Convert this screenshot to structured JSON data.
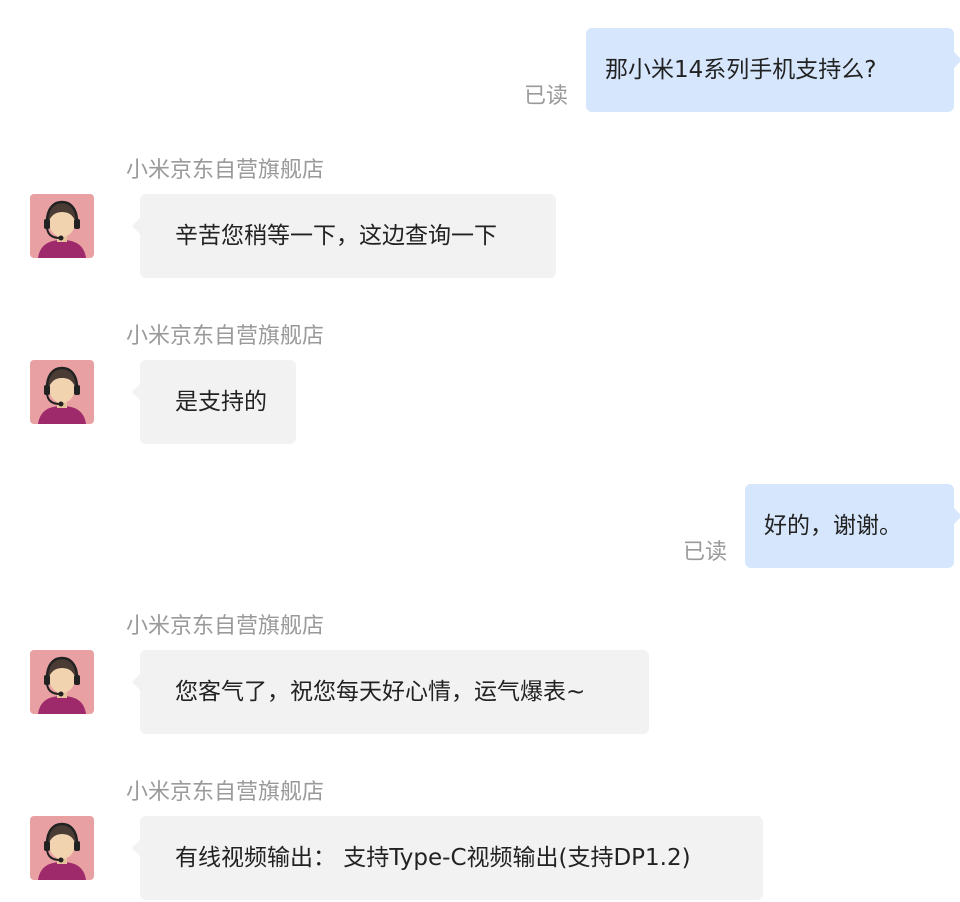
{
  "conversation": {
    "messages": [
      {
        "from": "user",
        "text": "那小米14系列手机支持么?",
        "status": "已读"
      },
      {
        "from": "shop",
        "sender": "小米京东自营旗舰店",
        "avatar_icon": "customer-service-agent-icon",
        "text": "辛苦您稍等一下，这边查询一下"
      },
      {
        "from": "shop",
        "sender": "小米京东自营旗舰店",
        "avatar_icon": "customer-service-agent-icon",
        "text": "是支持的"
      },
      {
        "from": "user",
        "text": "好的，谢谢。",
        "status": "已读"
      },
      {
        "from": "shop",
        "sender": "小米京东自营旗舰店",
        "avatar_icon": "customer-service-agent-icon",
        "text": "您客气了，祝您每天好心情，运气爆表~"
      },
      {
        "from": "shop",
        "sender": "小米京东自营旗舰店",
        "avatar_icon": "customer-service-agent-icon",
        "text": "有线视频输出：  支持Type-C视频输出(支持DP1.2)"
      }
    ]
  },
  "colors": {
    "outgoing_bubble": "#d6e7fd",
    "incoming_bubble": "#f2f2f2",
    "secondary_text": "#9a9a9a",
    "avatar_background": "#e8a0a3"
  }
}
